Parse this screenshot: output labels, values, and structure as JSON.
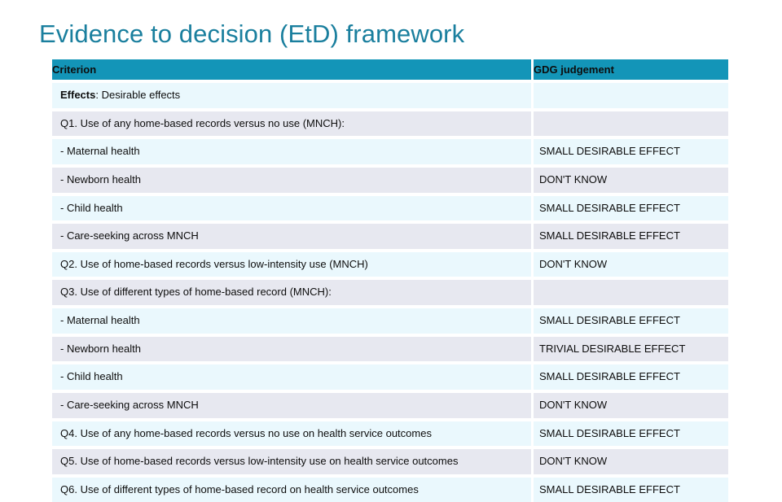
{
  "slide": {
    "title": "Evidence to decision (EtD) framework",
    "title_color": "#1a7f9e",
    "header_color": "#1395b8",
    "highlight_color": "#3fd9e8",
    "band_a_color": "#eaf8fd",
    "band_b_color": "#e7e8f0"
  },
  "table": {
    "columns": [
      {
        "key": "criterion",
        "label": "Criterion"
      },
      {
        "key": "judgement",
        "label": "GDG judgement"
      }
    ],
    "rows": [
      {
        "criterion_bold": "Effects",
        "criterion_rest": ": Desirable effects",
        "judgement": "",
        "band": "a",
        "highlight": false
      },
      {
        "criterion": "Q1. Use of any home-based records versus no use (MNCH):",
        "judgement": "",
        "band": "b",
        "highlight": false
      },
      {
        "criterion": "- Maternal health",
        "judgement": "SMALL DESIRABLE EFFECT",
        "band": "a",
        "highlight": true
      },
      {
        "criterion": "- Newborn health",
        "judgement": "DON'T KNOW",
        "band": "b",
        "highlight": false
      },
      {
        "criterion": "- Child health",
        "judgement": "SMALL DESIRABLE EFFECT",
        "band": "a",
        "highlight": true
      },
      {
        "criterion": "- Care-seeking across MNCH",
        "judgement": "SMALL DESIRABLE EFFECT",
        "band": "b",
        "highlight": true
      },
      {
        "criterion": "Q2. Use of home-based records versus low-intensity use (MNCH)",
        "judgement": "DON'T KNOW",
        "band": "a",
        "highlight": false
      },
      {
        "criterion": "Q3. Use of different types of home-based record (MNCH):",
        "judgement": "",
        "band": "b",
        "highlight": false
      },
      {
        "criterion": "- Maternal health",
        "judgement": "SMALL DESIRABLE EFFECT",
        "band": "a",
        "highlight": true
      },
      {
        "criterion": "- Newborn health",
        "judgement": "TRIVIAL DESIRABLE EFFECT",
        "band": "b",
        "highlight": false
      },
      {
        "criterion": "- Child health",
        "judgement": "SMALL DESIRABLE EFFECT",
        "band": "a",
        "highlight": true
      },
      {
        "criterion": "- Care-seeking across MNCH",
        "judgement": "DON'T KNOW",
        "band": "b",
        "highlight": false
      },
      {
        "criterion": "Q4. Use of any home-based records versus no use on health service outcomes",
        "judgement": "SMALL DESIRABLE EFFECT",
        "band": "a",
        "highlight": true
      },
      {
        "criterion": "Q5. Use of home-based records versus low-intensity use on health service outcomes",
        "judgement": "DON'T KNOW",
        "band": "b",
        "highlight": false
      },
      {
        "criterion": "Q6. Use of different types of home-based record on health service outcomes",
        "judgement": "SMALL DESIRABLE EFFECT",
        "band": "a",
        "highlight": true
      }
    ]
  }
}
